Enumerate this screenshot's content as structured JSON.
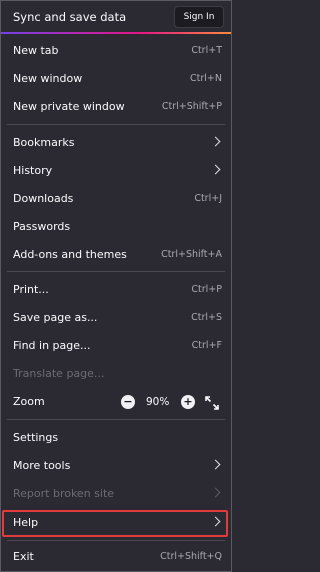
{
  "header": {
    "title": "Sync and save data",
    "sign_in_label": "Sign In"
  },
  "items": {
    "new_tab": {
      "label": "New tab",
      "shortcut": "Ctrl+T"
    },
    "new_window": {
      "label": "New window",
      "shortcut": "Ctrl+N"
    },
    "new_private_window": {
      "label": "New private window",
      "shortcut": "Ctrl+Shift+P"
    },
    "bookmarks": {
      "label": "Bookmarks"
    },
    "history": {
      "label": "History"
    },
    "downloads": {
      "label": "Downloads",
      "shortcut": "Ctrl+J"
    },
    "passwords": {
      "label": "Passwords"
    },
    "addons": {
      "label": "Add-ons and themes",
      "shortcut": "Ctrl+Shift+A"
    },
    "print": {
      "label": "Print...",
      "shortcut": "Ctrl+P"
    },
    "save_page": {
      "label": "Save page as...",
      "shortcut": "Ctrl+S"
    },
    "find_in_page": {
      "label": "Find in page...",
      "shortcut": "Ctrl+F"
    },
    "translate_page": {
      "label": "Translate page..."
    },
    "zoom": {
      "label": "Zoom",
      "minus": "−",
      "value": "90%",
      "plus": "+"
    },
    "settings": {
      "label": "Settings"
    },
    "more_tools": {
      "label": "More tools"
    },
    "report_broken_site": {
      "label": "Report broken site"
    },
    "help": {
      "label": "Help"
    },
    "exit": {
      "label": "Exit",
      "shortcut": "Ctrl+Shift+Q"
    }
  },
  "colors": {
    "background": "#2b2a33",
    "text": "#fbfbfe",
    "shortcut_text": "#a9a8b0",
    "disabled_text": "#6c6b73",
    "highlight_border": "#e33b3b"
  }
}
